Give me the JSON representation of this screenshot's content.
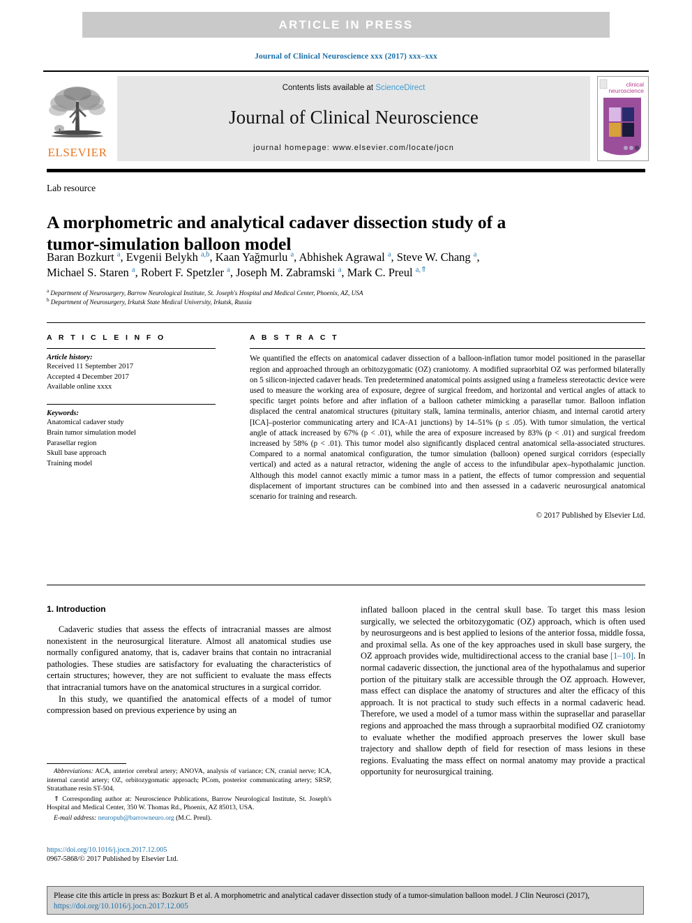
{
  "banner": {
    "text": "ARTICLE IN PRESS"
  },
  "running_head": "Journal of Clinical Neuroscience xxx (2017) xxx–xxx",
  "masthead": {
    "contents_prefix": "Contents lists available at ",
    "sciencedirect": "ScienceDirect",
    "journal_title": "Journal of Clinical Neuroscience",
    "homepage": "journal homepage: www.elsevier.com/locate/jocn",
    "publisher_wordmark": "ELSEVIER",
    "cover": {
      "title_line1": "clinical",
      "title_line2": "neuroscience"
    }
  },
  "article": {
    "type": "Lab resource",
    "title": "A morphometric and analytical cadaver dissection study of a tumor-simulation balloon model",
    "authors_line1": "Baran Bozkurt <sup>a</sup>, Evgenii Belykh <sup>a,b</sup>, Kaan Yağmurlu <sup>a</sup>, Abhishek Agrawal <sup>a</sup>, Steve W. Chang <sup>a</sup>,",
    "authors_line2": "Michael S. Staren <sup>a</sup>, Robert F. Spetzler <sup>a</sup>, Joseph M. Zabramski <sup>a</sup>, Mark C. Preul <sup>a,</sup><sup>⇑</sup>",
    "affiliation_a": "<sup>a</sup> Department of Neurosurgery, Barrow Neurological Institute, St. Joseph's Hospital and Medical Center, Phoenix, AZ, USA",
    "affiliation_b": "<sup>b</sup> Department of Neurosurgery, Irkutsk State Medical University, Irkutsk, Russia"
  },
  "info": {
    "heading": "A R T I C L E   I N F O",
    "history_label": "Article history:",
    "history": [
      "Received 11 September 2017",
      "Accepted 4 December 2017",
      "Available online xxxx"
    ],
    "keywords_label": "Keywords:",
    "keywords": [
      "Anatomical cadaver study",
      "Brain tumor simulation model",
      "Parasellar region",
      "Skull base approach",
      "Training model"
    ]
  },
  "abstract": {
    "heading": "A B S T R A C T",
    "text": "We quantified the effects on anatomical cadaver dissection of a balloon-inflation tumor model positioned in the parasellar region and approached through an orbitozygomatic (OZ) craniotomy. A modified supraorbital OZ was performed bilaterally on 5 silicon-injected cadaver heads. Ten predetermined anatomical points assigned using a frameless stereotactic device were used to measure the working area of exposure, degree of surgical freedom, and horizontal and vertical angles of attack to specific target points before and after inflation of a balloon catheter mimicking a parasellar tumor. Balloon inflation displaced the central anatomical structures (pituitary stalk, lamina terminalis, anterior chiasm, and internal carotid artery [ICA]–posterior communicating artery and ICA-A1 junctions) by 14–51% (p ≤ .05). With tumor simulation, the vertical angle of attack increased by 67% (p < .01), while the area of exposure increased by 83% (p < .01) and surgical freedom increased by 58% (p < .01). This tumor model also significantly displaced central anatomical sella-associated structures. Compared to a normal anatomical configuration, the tumor simulation (balloon) opened surgical corridors (especially vertical) and acted as a natural retractor, widening the angle of access to the infundibular apex–hypothalamic junction. Although this model cannot exactly mimic a tumor mass in a patient, the effects of tumor compression and sequential displacement of important structures can be combined into and then assessed in a cadaveric neurosurgical anatomical scenario for training and research.",
    "copyright": "© 2017 Published by Elsevier Ltd."
  },
  "body": {
    "section_title": "1. Introduction",
    "left_p1": "Cadaveric studies that assess the effects of intracranial masses are almost nonexistent in the neurosurgical literature. Almost all anatomical studies use normally configured anatomy, that is, cadaver brains that contain no intracranial pathologies. These studies are satisfactory for evaluating the characteristics of certain structures; however, they are not sufficient to evaluate the mass effects that intracranial tumors have on the anatomical structures in a surgical corridor.",
    "left_p2": "In this study, we quantified the anatomical effects of a model of tumor compression based on previous experience by using an",
    "right_p1_part1": "inflated balloon placed in the central skull base. To target this mass lesion surgically, we selected the orbitozygomatic (OZ) approach, which is often used by neurosurgeons and is best applied to lesions of the anterior fossa, middle fossa, and proximal sella. As one of the key approaches used in skull base surgery, the OZ approach provides wide, multidirectional access to the cranial base ",
    "right_p1_citation": "[1–10]",
    "right_p1_part2": ". In normal cadaveric dissection, the junctional area of the hypothalamus and superior portion of the pituitary stalk are accessible through the OZ approach. However, mass effect can displace the anatomy of structures and alter the efficacy of this approach. It is not practical to study such effects in a normal cadaveric head. Therefore, we used a model of a tumor mass within the suprasellar and parasellar regions and approached the mass through a supraorbital modified OZ craniotomy to evaluate whether the modified approach preserves the lower skull base trajectory and shallow depth of field for resection of mass lesions in these regions. Evaluating the mass effect on normal anatomy may provide a practical opportunity for neurosurgical training."
  },
  "footnotes": {
    "abbreviations_label": "Abbreviations:",
    "abbreviations_text": " ACA, anterior cerebral artery; ANOVA, analysis of variance; CN, cranial nerve; ICA, internal carotid artery; OZ, orbitozygomatic approach; PCom, posterior communicating artery; SRSP, Stratathane resin ST-504.",
    "corresponding_marker": "⇑",
    "corresponding_text": " Corresponding author at: Neuroscience Publications, Barrow Neurological Institute, St. Joseph's Hospital and Medical Center, 350 W. Thomas Rd., Phoenix, AZ 85013, USA.",
    "email_label": "E-mail address:",
    "email_address": "neuropub@barrowneuro.org",
    "email_suffix": " (M.C. Preul).",
    "doi_url": "https://doi.org/10.1016/j.jocn.2017.12.005",
    "issn_line": "0967-5868/© 2017 Published by Elsevier Ltd."
  },
  "citation_box": {
    "text_part1": "Please cite this article in press as: Bozkurt B et al. A morphometric and analytical cadaver dissection study of a tumor-simulation balloon model. J Clin Neurosci (2017), ",
    "link": "https://doi.org/10.1016/j.jocn.2017.12.005"
  },
  "colors": {
    "link_blue": "#1a6fa8",
    "sciencedirect_blue": "#3d9cd2",
    "elsevier_orange": "#e87722",
    "banner_gray": "#c9c9c9",
    "masthead_gray": "#e6e6e6",
    "citebox_gray": "#d4d4d4"
  }
}
